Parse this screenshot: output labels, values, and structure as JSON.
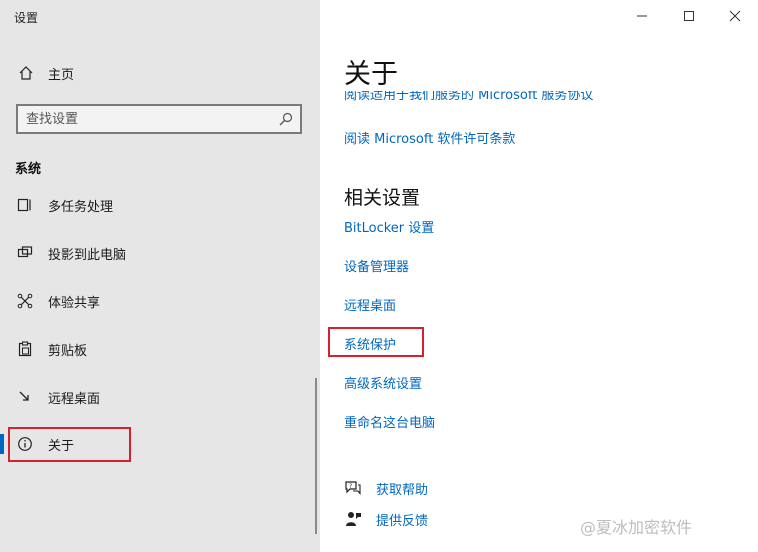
{
  "window": {
    "title": "设置",
    "controls": {
      "minimize": "—",
      "maximize": "☐",
      "close": "✕"
    }
  },
  "sidebar": {
    "home_label": "主页",
    "search": {
      "placeholder": "查找设置",
      "value": ""
    },
    "section_label": "系统",
    "items": [
      {
        "label": "多任务处理",
        "icon": "multitasking-icon"
      },
      {
        "label": "投影到此电脑",
        "icon": "project-icon"
      },
      {
        "label": "体验共享",
        "icon": "share-icon"
      },
      {
        "label": "剪贴板",
        "icon": "clipboard-icon"
      },
      {
        "label": "远程桌面",
        "icon": "remote-desktop-icon"
      },
      {
        "label": "关于",
        "icon": "info-icon",
        "selected": true
      }
    ]
  },
  "main": {
    "title": "关于",
    "links_top": [
      "阅读适用于我们服务的 Microsoft 服务协议",
      "阅读 Microsoft 软件许可条款"
    ],
    "related_title": "相关设置",
    "related_links": [
      "BitLocker 设置",
      "设备管理器",
      "远程桌面",
      "系统保护",
      "高级系统设置",
      "重命名这台电脑"
    ],
    "help": [
      {
        "label": "获取帮助",
        "icon": "help-chat-icon"
      },
      {
        "label": "提供反馈",
        "icon": "feedback-icon"
      }
    ]
  },
  "watermark": "@夏冰加密软件",
  "colors": {
    "accent": "#0067c0",
    "highlight": "#d3232f",
    "sidebar_bg": "#e6e6e6"
  }
}
